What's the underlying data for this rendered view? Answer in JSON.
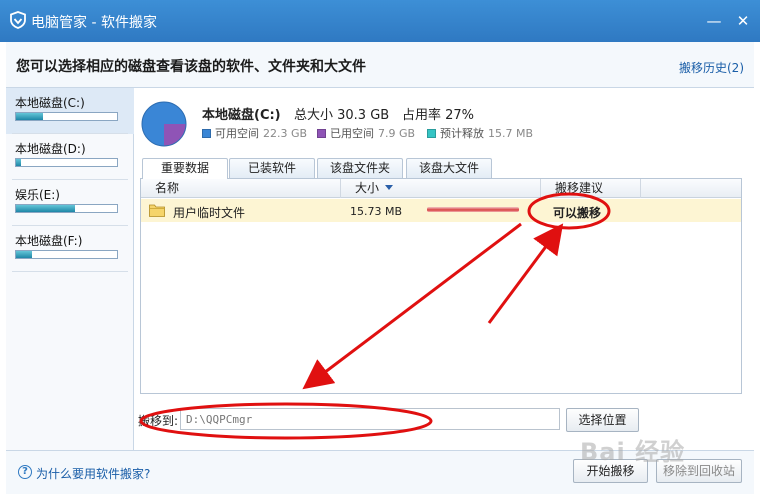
{
  "window": {
    "title": "电脑管家 - 软件搬家",
    "minimize": "—",
    "close": "✕"
  },
  "header": {
    "heading": "您可以选择相应的磁盘查看该盘的软件、文件夹和大文件",
    "history": "搬移历史(2)"
  },
  "sidebar": {
    "items": [
      {
        "label": "本地磁盘(C:)",
        "fill": 0.27
      },
      {
        "label": "本地磁盘(D:)",
        "fill": 0.05
      },
      {
        "label": "娱乐(E:)",
        "fill": 0.58
      },
      {
        "label": "本地磁盘(F:)",
        "fill": 0.16
      }
    ]
  },
  "disk": {
    "name": "本地磁盘(C:)",
    "total": "总大小 30.3 GB",
    "usage": "占用率 27%",
    "free_label": "可用空间",
    "free_value": "22.3 GB",
    "used_label": "已用空间",
    "used_value": "7.9 GB",
    "release_label": "预计释放",
    "release_value": "15.7 MB",
    "colors": {
      "free": "#3a86d6",
      "used": "#8f54b6",
      "release": "#35c4c4"
    }
  },
  "tabs": [
    "重要数据",
    "已装软件",
    "该盘文件夹",
    "该盘大文件"
  ],
  "table": {
    "columns": [
      "名称",
      "大小",
      "搬移建议"
    ],
    "rows": [
      {
        "name": "用户临时文件",
        "size": "15.73 MB",
        "advice": "可以搬移"
      }
    ]
  },
  "move": {
    "label": "搬移到:",
    "value": "D:\\QQPCmgr",
    "choose": "选择位置"
  },
  "footer": {
    "help": "为什么要用软件搬家?",
    "start": "开始搬移",
    "recycle": "移除到回收站"
  },
  "watermark": "Bai 经验"
}
